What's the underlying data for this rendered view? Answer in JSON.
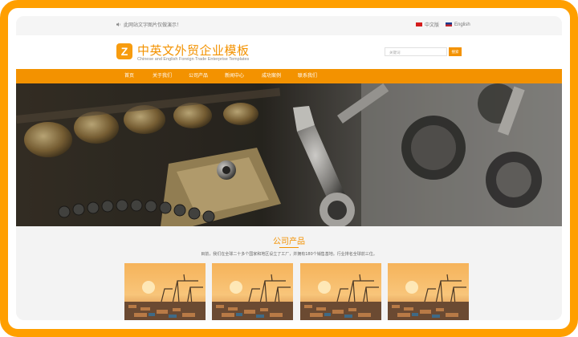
{
  "topbar": {
    "notice": "此网站文字图片仅做演示！",
    "languages": [
      {
        "label": "中文版",
        "flag": "cn-flag-icon"
      },
      {
        "label": "English",
        "flag": "us-flag-icon"
      }
    ]
  },
  "header": {
    "logo_letter": "Z",
    "title": "中英文外贸企业模板",
    "subtitle": "Chinese and English Foreign Trade Enterprise Templates",
    "search_placeholder": "关键词",
    "search_button": "搜索"
  },
  "nav": {
    "items": [
      {
        "label": "首页"
      },
      {
        "label": "关于我们"
      },
      {
        "label": "公司产品"
      },
      {
        "label": "新闻中心"
      },
      {
        "label": "成功案例"
      },
      {
        "label": "联系我们"
      }
    ]
  },
  "products": {
    "title": "公司产品",
    "description": "目前，我们在全球二十多个国家和地区设立了工厂，并拥有180个销售基地。行业排名全球前三位。"
  },
  "colors": {
    "accent": "#f39200",
    "frame": "#ff9f00"
  }
}
